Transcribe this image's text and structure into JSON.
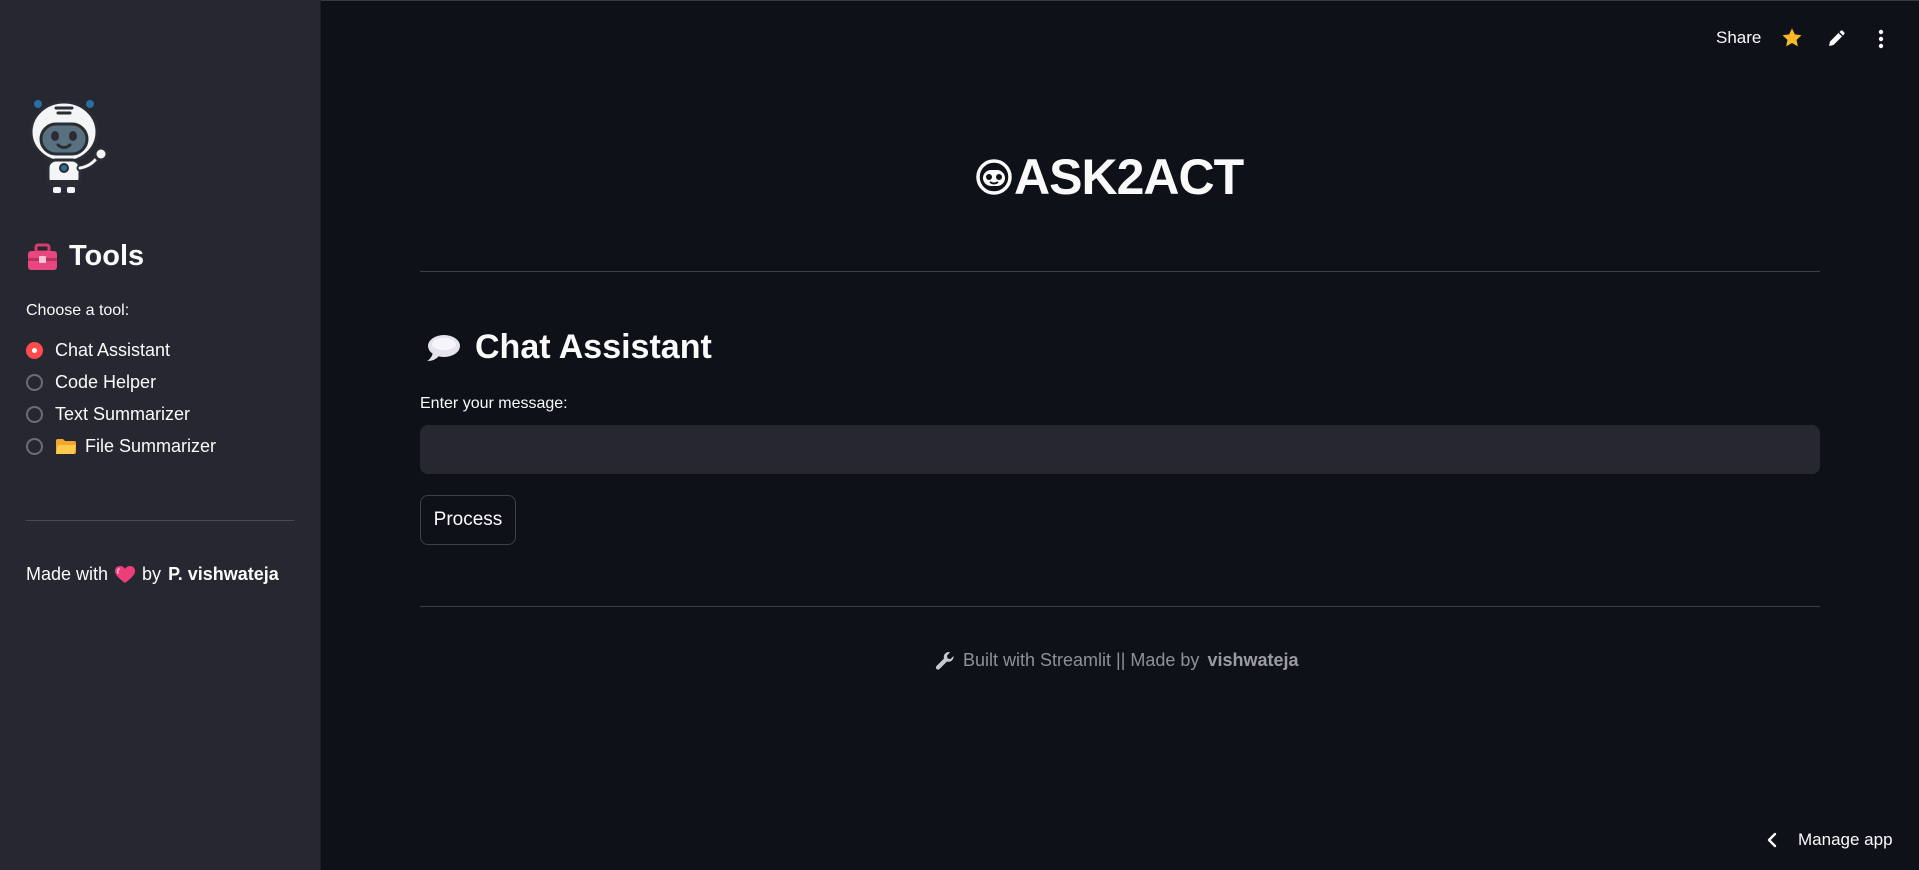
{
  "header": {
    "share_label": "Share",
    "icons": [
      "star-icon",
      "edit-icon",
      "more-vertical-icon"
    ]
  },
  "sidebar": {
    "logo": "robot-mascot",
    "title": "Tools",
    "title_icon": "toolbox-icon",
    "radio_label": "Choose a tool:",
    "options": [
      {
        "label": "Chat Assistant",
        "selected": true
      },
      {
        "label": "Code Helper",
        "selected": false
      },
      {
        "label": "Text Summarizer",
        "selected": false
      },
      {
        "label": "File Summarizer",
        "selected": false,
        "icon": "folder-icon"
      }
    ],
    "made_with_prefix": "Made with",
    "made_with_by": "by",
    "author": "P. vishwateja"
  },
  "main": {
    "app_title": "ASK2ACT",
    "section_title": "Chat Assistant",
    "input_label": "Enter your message:",
    "input_value": "",
    "button_label": "Process",
    "footer_prefix": "Built with Streamlit || Made by",
    "footer_author": "vishwateja"
  },
  "bottom": {
    "manage_label": "Manage app"
  },
  "colors": {
    "background": "#0e1117",
    "sidebar": "#262730",
    "accent": "#ff4b4b",
    "text": "#fafafa",
    "muted": "#8f9099"
  }
}
